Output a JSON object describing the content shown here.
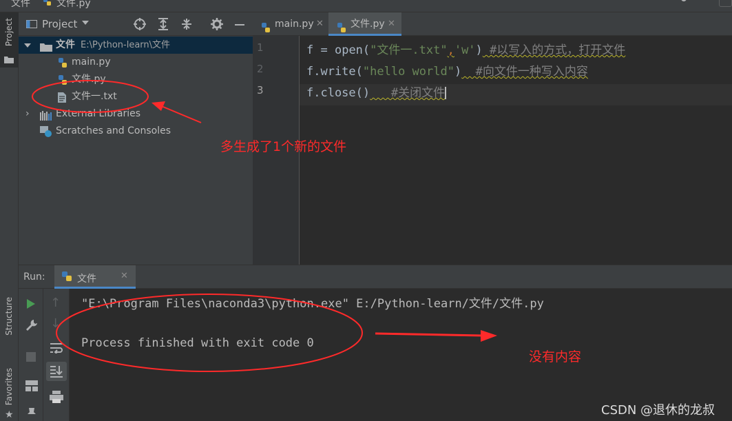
{
  "topbar": {
    "menu_label": "文件",
    "file_label": "文件.py"
  },
  "left_strip": {
    "project_tab": "Project",
    "structure_tab": "Structure",
    "favorites_tab": "Favorites"
  },
  "project": {
    "title": "Project",
    "root": {
      "name": "文件",
      "path": "E:\\Python-learn\\文件"
    },
    "files": [
      "main.py",
      "文件.py",
      "文件一.txt"
    ],
    "external_libraries": "External Libraries",
    "scratches": "Scratches and Consoles"
  },
  "editor": {
    "tabs": [
      {
        "label": "main.py",
        "active": false
      },
      {
        "label": "文件.py",
        "active": true
      }
    ],
    "line_numbers": [
      "1",
      "2",
      "3"
    ],
    "lines": [
      {
        "var": "f",
        "eq": " = ",
        "fn": "open(",
        "s1": "\"文件一.txt\"",
        "comma": ",",
        "s2": "'w'",
        "close": ")",
        "cmt": " #以写入的方式，打开文件"
      },
      {
        "head": "f.write(",
        "s1": "\"hello world\"",
        "close": ")",
        "cmt": "  #向文件一种写入内容"
      },
      {
        "head": "f.close()",
        "cmt": "   #关闭文件"
      }
    ]
  },
  "run": {
    "label": "Run:",
    "tab_label": "文件",
    "console": [
      "\"E:\\Program Files\\naconda3\\python.exe\" E:/Python-learn/文件/文件.py",
      "",
      "Process finished with exit code 0"
    ]
  },
  "annotations": {
    "new_file_note": "多生成了1个新的文件",
    "no_content_note": "没有内容",
    "color": "#ff2a2a"
  },
  "watermark": "CSDN @退休的龙叔",
  "colors": {
    "accent": "#4a88c7",
    "run_green": "#499c54",
    "string": "#6a8759",
    "comment": "#808080"
  }
}
